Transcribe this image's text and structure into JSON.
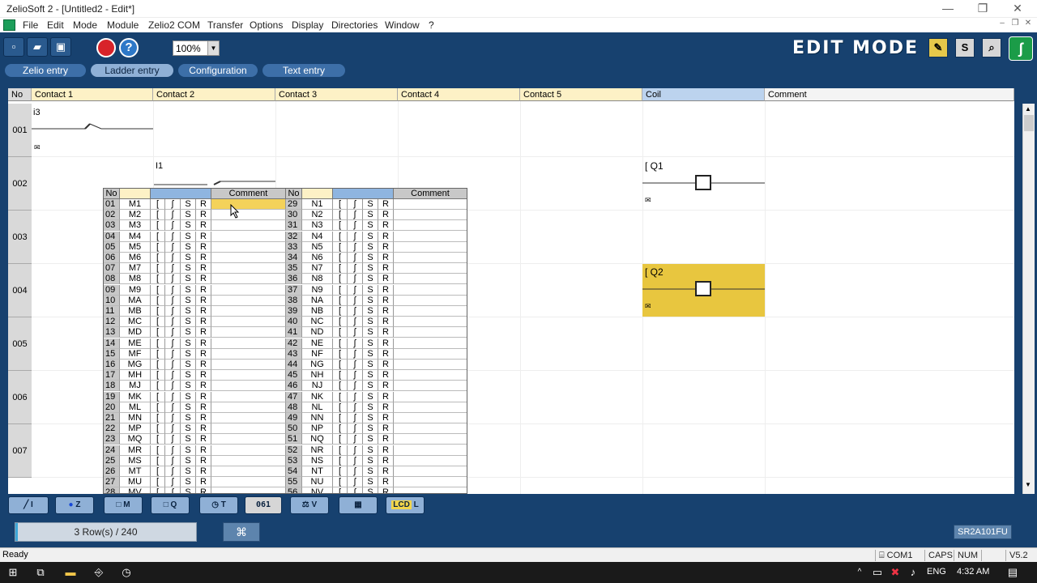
{
  "window": {
    "title": "ZelioSoft 2 - [Untitled2 - Edit*]",
    "minimize": "—",
    "restore": "❐",
    "close": "✕"
  },
  "menu": [
    "File",
    "Edit",
    "Mode",
    "Module",
    "Zelio2 COM",
    "Transfer",
    "Options",
    "Display",
    "Directories",
    "Window",
    "?"
  ],
  "mdi": {
    "minimize": "–",
    "restore": "❐",
    "close": "✕"
  },
  "toolbar": {
    "zoom": "100%",
    "edit_mode": "EDIT MODE",
    "help": "?",
    "s_label": "S"
  },
  "tabs": [
    "Zelio entry",
    "Ladder entry",
    "Configuration",
    "Text entry"
  ],
  "grid": {
    "headers": [
      "No",
      "Contact 1",
      "Contact 2",
      "Contact 3",
      "Contact 4",
      "Contact 5",
      "Coil",
      "Comment"
    ],
    "rows": [
      "001",
      "002",
      "003",
      "004",
      "005",
      "006",
      "007"
    ],
    "r1_contact": "i3",
    "r2_contact": "I1",
    "r2_coil": "[ Q1",
    "r4_coil": "[ Q2"
  },
  "popup": {
    "headers": {
      "no": "No",
      "comment": "Comment"
    },
    "symbols": [
      "[",
      "ʃ",
      "S",
      "R"
    ],
    "left": [
      [
        "01",
        "M1"
      ],
      [
        "02",
        "M2"
      ],
      [
        "03",
        "M3"
      ],
      [
        "04",
        "M4"
      ],
      [
        "05",
        "M5"
      ],
      [
        "06",
        "M6"
      ],
      [
        "07",
        "M7"
      ],
      [
        "08",
        "M8"
      ],
      [
        "09",
        "M9"
      ],
      [
        "10",
        "MA"
      ],
      [
        "11",
        "MB"
      ],
      [
        "12",
        "MC"
      ],
      [
        "13",
        "MD"
      ],
      [
        "14",
        "ME"
      ],
      [
        "15",
        "MF"
      ],
      [
        "16",
        "MG"
      ],
      [
        "17",
        "MH"
      ],
      [
        "18",
        "MJ"
      ],
      [
        "19",
        "MK"
      ],
      [
        "20",
        "ML"
      ],
      [
        "21",
        "MN"
      ],
      [
        "22",
        "MP"
      ],
      [
        "23",
        "MQ"
      ],
      [
        "24",
        "MR"
      ],
      [
        "25",
        "MS"
      ],
      [
        "26",
        "MT"
      ],
      [
        "27",
        "MU"
      ],
      [
        "28",
        "MV"
      ]
    ],
    "right": [
      [
        "29",
        "N1"
      ],
      [
        "30",
        "N2"
      ],
      [
        "31",
        "N3"
      ],
      [
        "32",
        "N4"
      ],
      [
        "33",
        "N5"
      ],
      [
        "34",
        "N6"
      ],
      [
        "35",
        "N7"
      ],
      [
        "36",
        "N8"
      ],
      [
        "37",
        "N9"
      ],
      [
        "38",
        "NA"
      ],
      [
        "39",
        "NB"
      ],
      [
        "40",
        "NC"
      ],
      [
        "41",
        "ND"
      ],
      [
        "42",
        "NE"
      ],
      [
        "43",
        "NF"
      ],
      [
        "44",
        "NG"
      ],
      [
        "45",
        "NH"
      ],
      [
        "46",
        "NJ"
      ],
      [
        "47",
        "NK"
      ],
      [
        "48",
        "NL"
      ],
      [
        "49",
        "NN"
      ],
      [
        "50",
        "NP"
      ],
      [
        "51",
        "NQ"
      ],
      [
        "52",
        "NR"
      ],
      [
        "53",
        "NS"
      ],
      [
        "54",
        "NT"
      ],
      [
        "55",
        "NU"
      ],
      [
        "56",
        "NV"
      ]
    ]
  },
  "lowtoolbar": {
    "btn1": "I",
    "btn2": "Z",
    "btn3": "M",
    "btn4": "Q",
    "btn5": "T",
    "counter": "061",
    "btn7": "V",
    "lcd": "LCD",
    "lcd_l": "L"
  },
  "progress": {
    "text": "3 Row(s) / 240",
    "fraction": 0.0125
  },
  "model": "SR2A101FU",
  "status": {
    "ready": "Ready",
    "com": "COM1",
    "caps": "CAPS",
    "num": "NUM",
    "version": "V5.2"
  },
  "taskbar": {
    "lang": "ENG",
    "time": "4:32 AM"
  }
}
